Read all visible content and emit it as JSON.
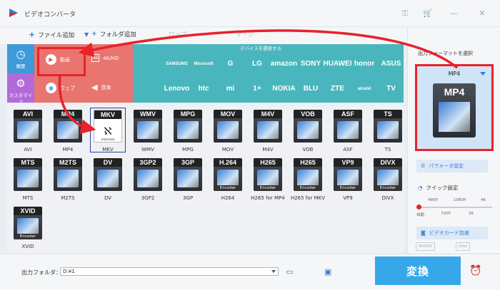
{
  "window": {
    "title": "ビデオコンバータ"
  },
  "toolbar": {
    "add_file": "ファイル追加",
    "add_folder": "フォルダ追加",
    "faded1": "ロップ",
    "faded2": "マージ"
  },
  "categories": {
    "history": "履歴",
    "custom": "カスタマイズ",
    "video": "動画",
    "fourk": "4K/HD",
    "web": "ウェブ",
    "audio": "音楽",
    "device_header": "デバイスを選択する",
    "devices_row1": [
      "",
      "SAMSUNG",
      "Microsoft",
      "G",
      "LG",
      "amazon",
      "SONY",
      "HUAWEI",
      "honor",
      "ASUS"
    ],
    "devices_row2": [
      "",
      "Lenovo",
      "htc",
      "mi",
      "1+",
      "NOKIA",
      "BLU",
      "ZTE",
      "alcatel",
      "TV"
    ]
  },
  "formats": [
    {
      "label": "AVI",
      "name": "AVI"
    },
    {
      "label": "MP4",
      "name": "MP4"
    },
    {
      "label": "MKV",
      "name": "MKV"
    },
    {
      "label": "WMV",
      "name": "WMV"
    },
    {
      "label": "MPG",
      "name": "MPG"
    },
    {
      "label": "MOV",
      "name": "MOV"
    },
    {
      "label": "M4V",
      "name": "M4V"
    },
    {
      "label": "VOB",
      "name": "VOB"
    },
    {
      "label": "ASF",
      "name": "ASF"
    },
    {
      "label": "TS",
      "name": "TS"
    },
    {
      "label": "MTS",
      "name": "MTS"
    },
    {
      "label": "M2TS",
      "name": "M2TS"
    },
    {
      "label": "DV",
      "name": "DV"
    },
    {
      "label": "3GP2",
      "name": "3GP2"
    },
    {
      "label": "3GP",
      "name": "3GP"
    },
    {
      "label": "H.264",
      "name": "H264"
    },
    {
      "label": "H265",
      "name": "H265 for MP4"
    },
    {
      "label": "H265",
      "name": "H265 for MKV"
    },
    {
      "label": "VP9",
      "name": "VP9"
    },
    {
      "label": "DIVX",
      "name": "DIVX"
    },
    {
      "label": "XVID",
      "name": "XVID"
    }
  ],
  "encoder_tag": "Encoder",
  "mkv_art": "matroska",
  "right_panel": {
    "title": "出力フォーマットを選択",
    "selected_format": "MP4",
    "preview_label": "MP4",
    "param_button": "パラメータ設定",
    "quick_setting": "クイック設定",
    "slider_top": [
      "480P",
      "1080P",
      "4K"
    ],
    "slider_bottom": [
      "自動",
      "720P",
      "2K"
    ],
    "gpu_button": "ビデオカード加速",
    "hw": [
      "NVIDIA",
      "Intel"
    ]
  },
  "bottom": {
    "output_label": "出力フォルダ：",
    "output_path": "D:¥1",
    "convert": "変換"
  },
  "colors": {
    "accent": "#36a8ea",
    "highlight": "#e8232a",
    "video_cat": "#e87570",
    "device_strip": "#49b6bd"
  }
}
